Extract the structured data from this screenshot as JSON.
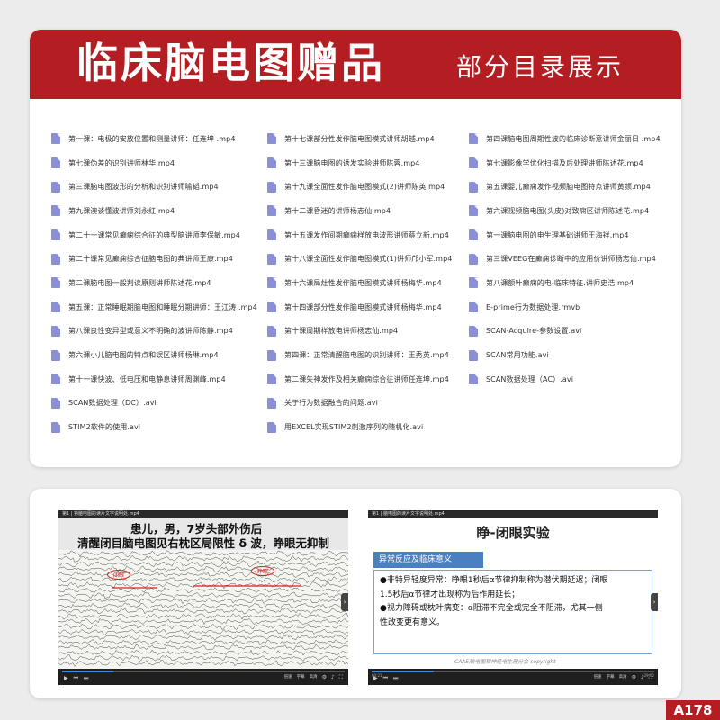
{
  "banner": {
    "title": "临床脑电图赠品",
    "subtitle": "部分目录展示"
  },
  "catalog": {
    "col1": [
      "第一课：电极的安放位置和测量讲师：任连坤 .mp4",
      "第七课伪差的识别讲师林华.mp4",
      "第三课脑电图波形的分析和识别讲师喻韬.mp4",
      "第九课澳谈懂波讲师刘永红.mp4",
      "第二十一课常见癫痫综合征的典型脑讲师李保敏.mp4",
      "第二十课常见癫痫综合征脑电图的典讲师王康.mp4",
      "第二课脑电图一般判读原则讲师陈述花.mp4",
      "第五课：正常睡眠期脑电图和睡眠分期讲师：王江涛 .mp4",
      "第八课良性变异型或意义不明确的波讲师陈静.mp4",
      "第六课小儿脑电图的特点和误区讲师杨琳.mp4",
      "第十一课快波、低电压和电静息讲师周渊峰.mp4",
      "SCAN数据处理（DC）.avi",
      "STIM2软件的使用.avi"
    ],
    "col2": [
      "第十七课部分性发作脑电图模式讲师胡越.mp4",
      "第十三课脑电图的诱发实验讲师陈蓉.mp4",
      "第十九课全面性发作脑电图模式(2)讲师陈英.mp4",
      "第十二课昏迷的讲师杨志仙.mp4",
      "第十五课发作间期癫痫样放电波形讲师蔡立新.mp4",
      "第十八课全面性发作脑电图模式(1)讲师邝小军.mp4",
      "第十六课局灶性发作脑电图模式讲师杨梅华.mp4",
      "第十四课部分性发作脑电图模式讲师杨梅华.mp4",
      "第十课周期样放电讲师杨志仙.mp4",
      "第四课：正常清醒脑电图的识别讲师：王秀英.mp4",
      "第二课失神发作及相关癫痫综合征讲师任连坤.mp4",
      "关于行为数据融合的问题.avi",
      "用EXCEL实现STIM2刺激序列的随机化.avi"
    ],
    "col3": [
      "第四课脑电图周期性波的临床诊断意讲师金丽日 .mp4",
      "第七课影像学优化扫描及后处理讲师陈述花.mp4",
      "第五课婴儿癫痫发作视频脑电图特点讲师黄颜.mp4",
      "第六课视频脑电图(头皮)对致痫区讲师陈述花.mp4",
      "第一课脑电图的电生理基础讲师王海祥.mp4",
      "第三课VEEG在癫痫诊断中的应用价讲师杨志仙.mp4",
      "第八课额叶癫痫的电-临床特征.讲师史浩.mp4",
      "E-prime行为数据处理.rmvb",
      "SCAN-Acquire-参数设置.avi",
      "SCAN常用功能.avi",
      "SCAN数据处理（AC）.avi"
    ]
  },
  "video1": {
    "topbar": "第1 | 第脑电图的读片文字说明处.mp4",
    "title_line1": "患儿，男，7岁头部外伤后",
    "title_line2": "清醒闭目脑电图见右枕区局限性 δ 波，睁眼无抑制",
    "tag_left": "闭眼",
    "tag_right": "睁眼",
    "progress": 0.18,
    "speed": "倍速",
    "subtitle": "字幕",
    "quality": "高清"
  },
  "video2": {
    "topbar": "第1 | 脑电图的读片文字说明处.mp4",
    "title": "睁-闭眼实验",
    "section": "异常反应及临床意义",
    "lines": [
      "●非特异轻度异常：睁眼1秒后α节律抑制称为潜伏期延迟；闭眼",
      "1.5秒后α节律才出现称为后作用延长；",
      "●视力障碍或枕叶病变：α阻滞不完全或完全不阻滞，尤其一侧",
      "性改变更有意义。"
    ],
    "footer": "CAAE脑电图和神经电生理分会    copyright",
    "progress": 0.22,
    "time_left": "00:21",
    "time_right": "29:02",
    "speed": "倍速",
    "subtitle": "字幕",
    "quality": "高清"
  },
  "corner_tag": "A178",
  "colors": {
    "brand": "#b41d22",
    "icon": "#8a8fd6"
  }
}
